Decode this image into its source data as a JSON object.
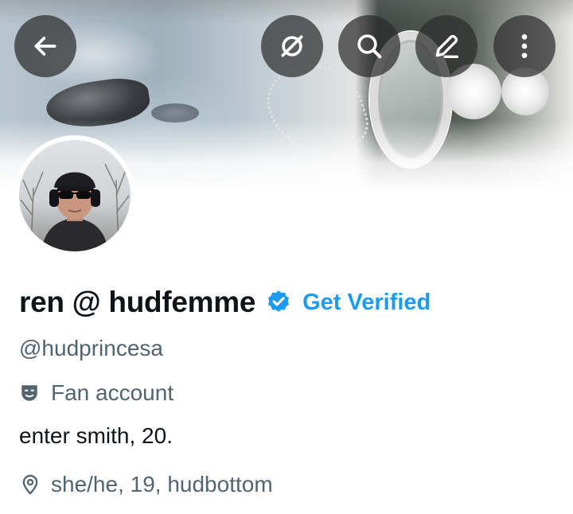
{
  "profile": {
    "display_name": "ren @ hudfemme",
    "verify_cta": "Get Verified",
    "handle": "@hudprincesa",
    "category": "Fan account",
    "bio": "enter smith, 20.",
    "location": "she/he, 19, hudbottom"
  },
  "header_actions": [
    {
      "icon": "back-arrow-icon"
    },
    {
      "icon": "grok-slash-icon"
    },
    {
      "icon": "search-icon"
    },
    {
      "icon": "edit-pencil-icon"
    },
    {
      "icon": "more-vertical-icon"
    }
  ],
  "colors": {
    "accent": "#1d9bf0",
    "text_primary": "#0f1419",
    "text_secondary": "#536471",
    "icon_button_bg": "#2d2d2d"
  }
}
